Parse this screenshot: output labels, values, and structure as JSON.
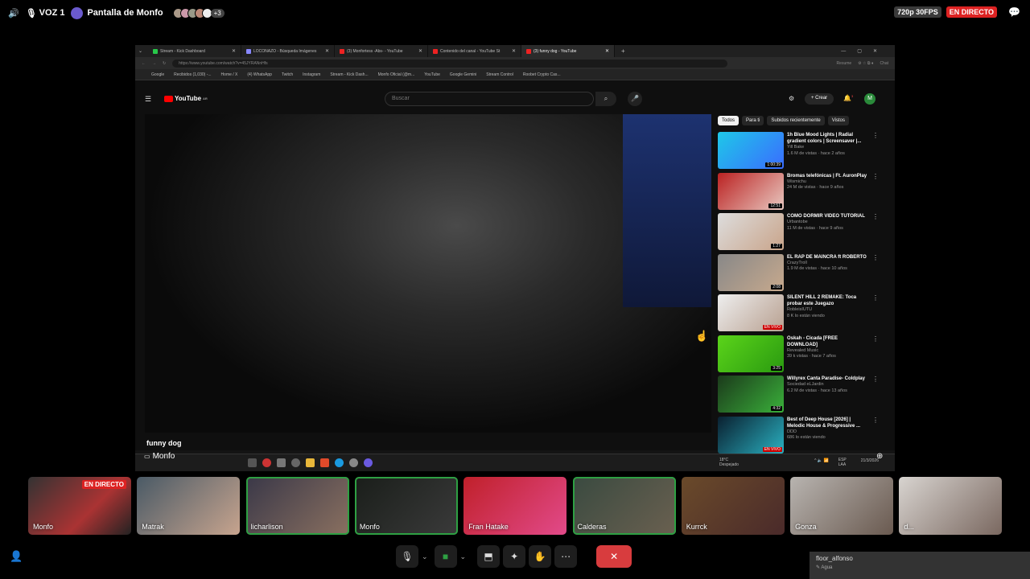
{
  "topbar": {
    "voice_channel": "VOZ 1",
    "stream_title": "Pantalla de Monfo",
    "extra_count": "+3",
    "quality": "720p 30FPS",
    "live_label": "EN DIRECTO"
  },
  "browser": {
    "tabs": [
      {
        "label": "Stream - Kick Dashboard",
        "color": "#28c84a"
      },
      {
        "label": "LOCONAZO - Búsqueda Imágenes",
        "color": "#8888ff"
      },
      {
        "label": "(3) Monfortess -Abs- - YouTube",
        "color": "#e22"
      },
      {
        "label": "Contenido del canal - YouTube St",
        "color": "#e22"
      },
      {
        "label": "(3) funny dog - YouTube",
        "color": "#e22"
      }
    ],
    "url": "https://www.youtube.com/watch?v=45JYRANnHfs",
    "resume_label": "Resume",
    "chat_label": "Chat",
    "bookmarks": [
      "Google",
      "Recibidos (1,030) -...",
      "Home / X",
      "(4) WhatsApp",
      "Twitch",
      "Instagram",
      "Stream - Kick Dash...",
      "Monfo Oficial (@m...",
      "YouTube",
      "Google Gemini",
      "Stream Control",
      "Roobet Crypto Cas..."
    ]
  },
  "youtube": {
    "logo": "YouTube",
    "region": "AR",
    "search_placeholder": "Buscar",
    "create_label": "Crear",
    "notif_count": "3",
    "avatar_letter": "M",
    "video_title": "funny dog",
    "chips": [
      "Todos",
      "Para ti",
      "Subidos recientemente",
      "Vistos"
    ],
    "recommendations": [
      {
        "title": "1h Blue Mood Lights | Radial gradient colors | Screensaver |...",
        "channel": "Yill Bake",
        "meta": "1.6 M de vistas · hace 2 años",
        "duration": "1:00:39",
        "thumb": "linear-gradient(135deg,#1ec8e8,#3a6cff)"
      },
      {
        "title": "Bromas telefónicas | Ft. AuronPlay",
        "channel": "Wismichu",
        "meta": "24 M de vistas · hace 9 años",
        "duration": "12:51",
        "thumb": "linear-gradient(135deg,#b22,#e8c8c0)"
      },
      {
        "title": "COMO DORMIR VIDEO TUTORIAL",
        "channel": "Urbantobe",
        "meta": "11 M de vistas · hace 9 años",
        "duration": "1:27",
        "thumb": "linear-gradient(135deg,#ddd,#c9a48a)"
      },
      {
        "title": "EL RAP DE MAINCRA ft ROBERTO",
        "channel": "CrazyTroll",
        "meta": "1.9 M de vistas · hace 10 años",
        "duration": "2:08",
        "thumb": "linear-gradient(135deg,#888,#c7a98d)"
      },
      {
        "title": "SILENT HILL 2 REMAKE: Toca probar este Juegazo",
        "channel": "RobleisIUTU",
        "meta": "8 K lo están viendo",
        "duration": "EN VIVO",
        "thumb": "linear-gradient(135deg,#eee,#b8a090)"
      },
      {
        "title": "Oskah - Cicada [FREE DOWNLOAD]",
        "channel": "Revealed Music",
        "meta": "39 k vistas · hace 7 años",
        "duration": "3:25",
        "thumb": "linear-gradient(135deg,#5bd41a,#2a9a10)"
      },
      {
        "title": "Willyrex Canta Paradise- Coldplay",
        "channel": "Sociedad eLJardin",
        "meta": "6.2 M de vistas · hace 13 años",
        "duration": "4:32",
        "thumb": "linear-gradient(135deg,#1b3a1b,#3ab03a)"
      },
      {
        "title": "Best of Deep House [2026] | Melodic House & Progressive ...",
        "channel": "DDD",
        "meta": "686 lo están viendo",
        "duration": "EN VIVO",
        "thumb": "linear-gradient(135deg,#0a2030,#2ab0c0)"
      }
    ]
  },
  "taskbar": {
    "weather": "18°C",
    "weather_desc": "Despejado",
    "lang": "ESP LAA",
    "date": "21/3/2026"
  },
  "screen_owner": "Monfo",
  "participants": [
    {
      "name": "Monfo",
      "live": "EN DIRECTO",
      "bg": "linear-gradient(135deg,#333,#a33 60%,#222)"
    },
    {
      "name": "Matrak",
      "bg": "linear-gradient(135deg,#4a5a66,#c7a48e)"
    },
    {
      "name": "licharlison",
      "bg": "linear-gradient(135deg,#3a3848,#8a7060)"
    },
    {
      "name": "Monfo",
      "bg": "linear-gradient(135deg,#1a1e1a,#3a3a3a)"
    },
    {
      "name": "Fran Hatake",
      "bg": "linear-gradient(135deg,#c0202a,#e24a8a)"
    },
    {
      "name": "Calderas",
      "bg": "linear-gradient(135deg,#3a4a40,#6a6050)"
    },
    {
      "name": "Kurrck",
      "bg": "linear-gradient(135deg,#6a4a2a,#4a2a2a)"
    },
    {
      "name": "Gonza",
      "bg": "linear-gradient(135deg,#b8b4b0,#6a5a50)"
    },
    {
      "name": "d...",
      "bg": "linear-gradient(135deg,#d8d4d0,#7a6860)"
    }
  ],
  "mini_panel": {
    "user": "floor_alfonso",
    "status": "Agua"
  }
}
